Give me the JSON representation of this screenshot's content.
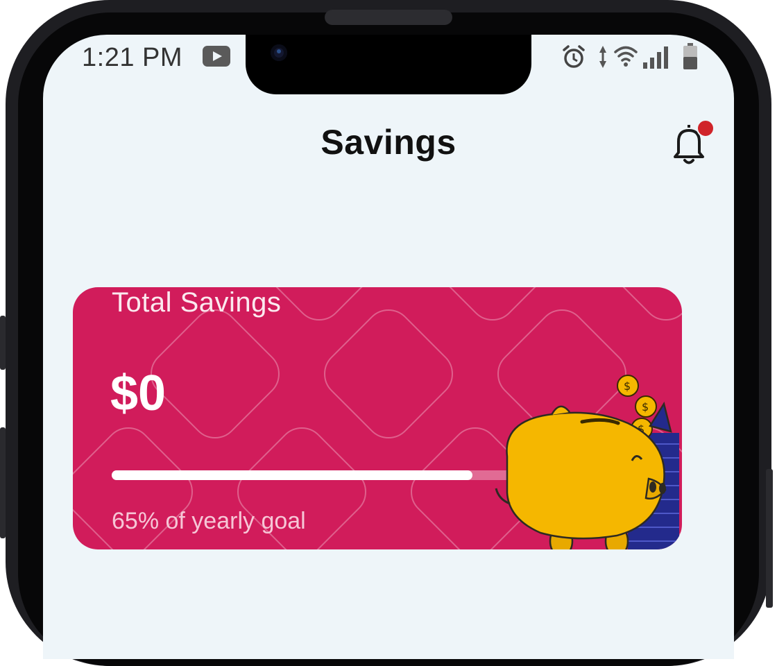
{
  "status_bar": {
    "time": "1:21 PM",
    "left_icons": [
      "youtube-icon"
    ],
    "right_icons": [
      "alarm-icon",
      "data-arrows-icon",
      "wifi-icon",
      "signal-icon",
      "battery-icon"
    ]
  },
  "header": {
    "title": "Savings",
    "notification_icon": "bell-icon",
    "has_unread": true
  },
  "savings_card": {
    "label": "Total Savings",
    "amount": "$0",
    "progress_fraction": 0.65,
    "progress_text": "65% of yearly goal",
    "illustration": "piggy-bank-with-coins"
  },
  "colors": {
    "screen_background": "#eef5f9",
    "card_background": "#d11c5b",
    "notification_dot": "#d0242a",
    "piggy_yellow": "#f5b700",
    "coin_stack_blue": "#232a8c"
  }
}
